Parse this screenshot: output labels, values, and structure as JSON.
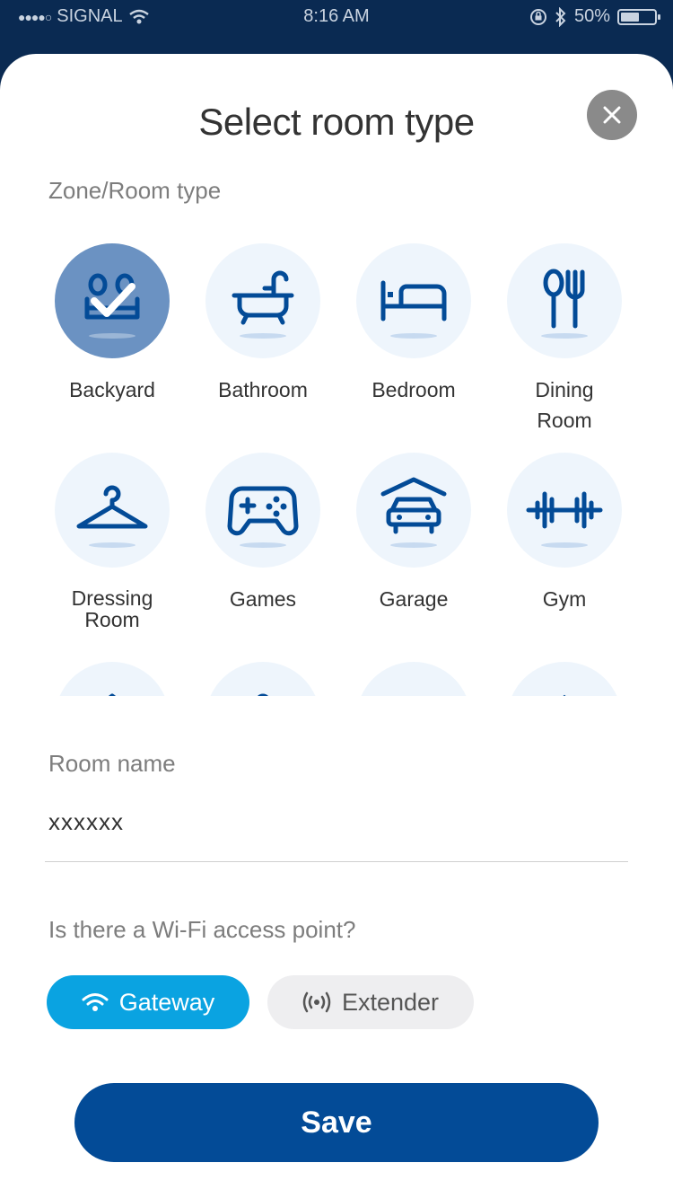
{
  "status_bar": {
    "carrier": "SIGNAL",
    "time": "8:16 AM",
    "battery": "50%",
    "battery_level": 0.5
  },
  "modal": {
    "title": "Select room type",
    "zone_label": "Zone/Room type",
    "rooms": [
      {
        "label": "Backyard",
        "icon": "backyard-icon",
        "selected": true
      },
      {
        "label": "Bathroom",
        "icon": "bathtub-icon",
        "selected": false
      },
      {
        "label": "Bedroom",
        "icon": "bed-icon",
        "selected": false
      },
      {
        "label": "Dining Room",
        "icon": "cutlery-icon",
        "selected": false
      },
      {
        "label": "Dressing Room",
        "icon": "hanger-icon",
        "selected": false
      },
      {
        "label": "Games",
        "icon": "gamepad-icon",
        "selected": false
      },
      {
        "label": "Garage",
        "icon": "car-garage-icon",
        "selected": false
      },
      {
        "label": "Gym",
        "icon": "dumbbell-icon",
        "selected": false
      }
    ],
    "room_name_label": "Room name",
    "room_name_value": "xxxxxx",
    "wifi_question": "Is there a Wi-Fi access point?",
    "wifi_options": [
      {
        "label": "Gateway",
        "icon": "wifi-icon",
        "selected": true
      },
      {
        "label": "Extender",
        "icon": "signal-broadcast-icon",
        "selected": false
      }
    ],
    "save_label": "Save"
  },
  "colors": {
    "header_bg": "#0a2a52",
    "accent_blue": "#034b97",
    "icon_blue": "#034b97",
    "selected_circle": "#6b92c2",
    "gateway_chip": "#0aa3e1",
    "circle_bg": "#eef5fc"
  }
}
